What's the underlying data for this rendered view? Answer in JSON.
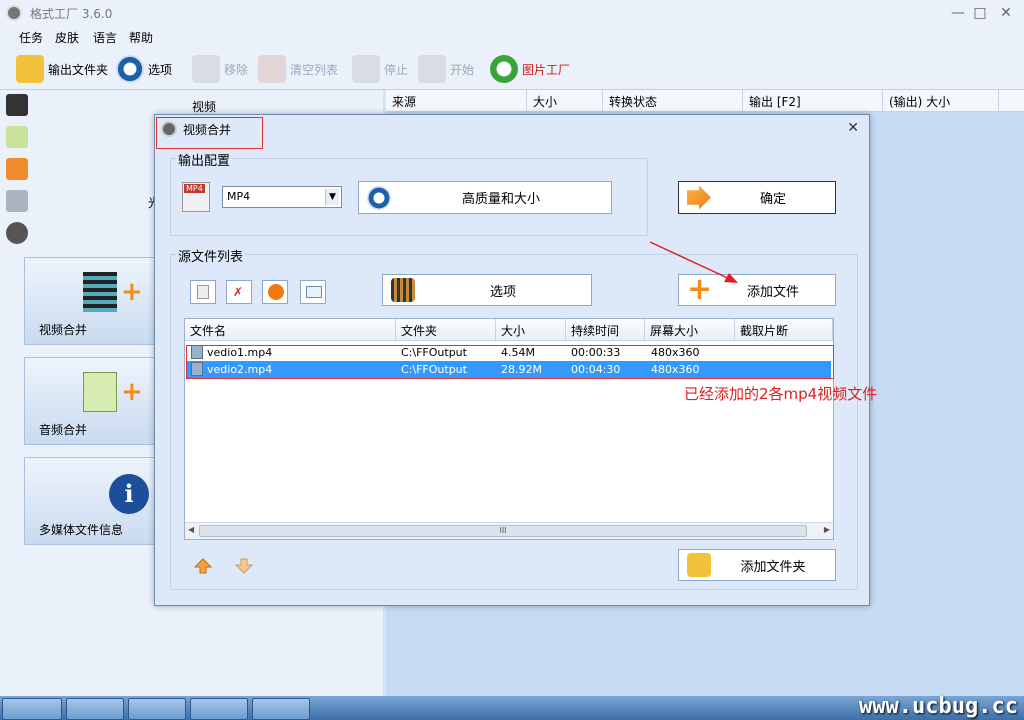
{
  "window": {
    "title": "格式工厂 3.6.0"
  },
  "menu": [
    "任务",
    "皮肤",
    "语言",
    "帮助"
  ],
  "toolbar": {
    "output_folder": "输出文件夹",
    "options": "选项",
    "remove": "移除",
    "clear_list": "清空列表",
    "stop": "停止",
    "start": "开始",
    "picture_factory": "图片工厂"
  },
  "leftpanel": {
    "category": "视频",
    "partial_label": "光",
    "tiles": [
      "视频合并",
      "音频合并",
      "多媒体文件信息"
    ]
  },
  "task_table": {
    "columns": [
      "来源",
      "大小",
      "转换状态",
      "输出 [F2]",
      "(输出) 大小"
    ]
  },
  "dialog": {
    "title": "视频合并",
    "output_group": "输出配置",
    "format_value": "MP4",
    "format_icon_label": "MP4",
    "quality_button": "高质量和大小",
    "ok_button": "确定",
    "source_group": "源文件列表",
    "options_button": "选项",
    "add_file_button": "添加文件",
    "add_folder_button": "添加文件夹",
    "file_columns": [
      "文件名",
      "文件夹",
      "大小",
      "持续时间",
      "屏幕大小",
      "截取片断"
    ],
    "files": [
      {
        "name": "vedio1.mp4",
        "folder": "C:\\FFOutput",
        "size": "4.54M",
        "duration": "00:00:33",
        "resolution": "480x360",
        "clip": ""
      },
      {
        "name": "vedio2.mp4",
        "folder": "C:\\FFOutput",
        "size": "28.92M",
        "duration": "00:04:30",
        "resolution": "480x360",
        "clip": ""
      }
    ],
    "scroll_grip": "III",
    "annotation": "已经添加的2各mp4视频文件"
  },
  "watermark": "www.ucbug.cc",
  "colors": {
    "accent_red": "#e02020",
    "selection": "#3399ff"
  }
}
